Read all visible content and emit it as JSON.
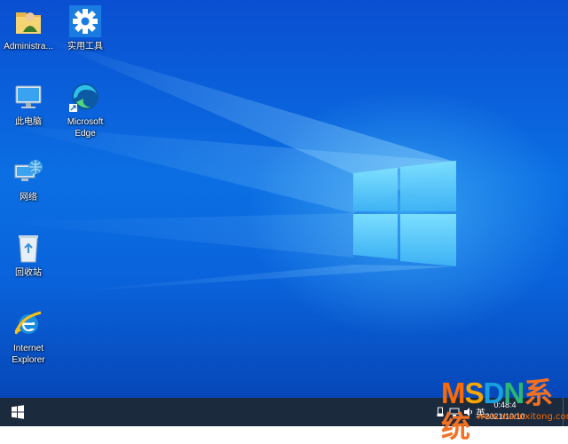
{
  "desktop_icons": [
    {
      "label": "Administra...",
      "icon": "user-folder-icon"
    },
    {
      "label": "实用工具",
      "icon": "gear-icon"
    },
    {
      "label": "此电脑",
      "icon": "computer-icon"
    },
    {
      "label": "Microsoft\nEdge",
      "icon": "edge-icon"
    },
    {
      "label": "网络",
      "icon": "network-icon"
    },
    {
      "label": "回收站",
      "icon": "recycle-bin-icon"
    },
    {
      "label": "Internet\nExplorer",
      "icon": "ie-icon"
    }
  ],
  "taskbar": {
    "start_icon": "windows-logo-icon",
    "tray_icons": [
      "usb-icon",
      "network-tray-icon",
      "volume-icon",
      "ime-icon"
    ],
    "ime_label": "英",
    "time": "0:48:4",
    "date": "2021/10/10"
  },
  "watermark": {
    "brand": "MSDN系统",
    "url": "www.msdnxitong.com",
    "colors": {
      "M": "#ff6a00",
      "S": "#f7a500",
      "D": "#17a0e0",
      "N": "#2bb673",
      "rest": "#f37021"
    }
  },
  "colors": {
    "desktop": "#0b6fe3",
    "taskbar": "#1c2a3d"
  }
}
